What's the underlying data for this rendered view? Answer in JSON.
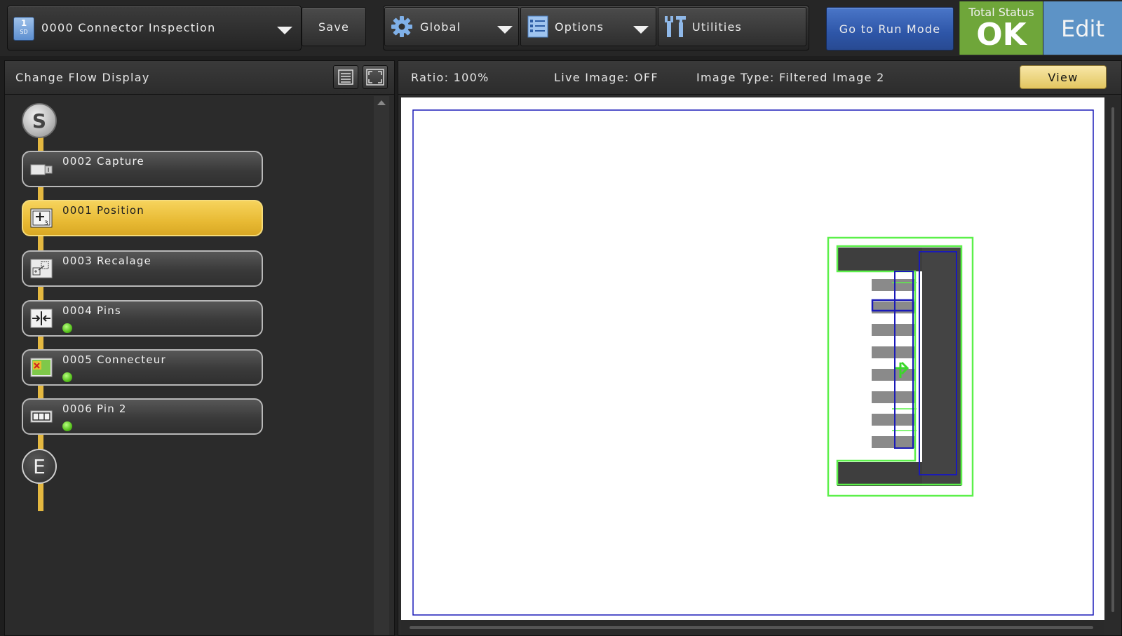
{
  "toolbar": {
    "scene": {
      "number": "1",
      "sub": "SD",
      "label": "0000  Connector  Inspection"
    },
    "save_label": "Save",
    "global_label": "Global",
    "options_label": "Options",
    "utilities_label": "Utilities",
    "run_mode_label": "Go  to  Run  Mode",
    "total_status_title": "Total Status",
    "total_status_value": "OK",
    "edit_label": "Edit"
  },
  "flow_panel": {
    "title": "Change  Flow  Display",
    "start_label": "S",
    "end_label": "E",
    "items": [
      {
        "label": "0002 Capture",
        "icon": "camera-icon",
        "active": false,
        "status": null
      },
      {
        "label": "0001 Position",
        "icon": "position-icon",
        "active": true,
        "status": null
      },
      {
        "label": "0003 Recalage",
        "icon": "recalage-icon",
        "active": false,
        "status": null
      },
      {
        "label": "0004 Pins",
        "icon": "pins-icon",
        "active": false,
        "status": "ok"
      },
      {
        "label": "0005 Connecteur",
        "icon": "connecteur-icon",
        "active": false,
        "status": "ok"
      },
      {
        "label": "0006 Pin  2",
        "icon": "pin2-icon",
        "active": false,
        "status": "ok"
      }
    ]
  },
  "image_panel": {
    "ratio_label": "Ratio:  100%",
    "live_label": "Live  Image:  OFF",
    "type_label": "Image  Type:  Filtered  Image  2",
    "view_label": "View"
  },
  "colors": {
    "accent_yellow": "#e8ba34",
    "status_ok_green": "#6fa63a",
    "edit_blue": "#5d93c6",
    "run_mode_blue": "#2e56a8",
    "roi_green": "#5cf04a",
    "roi_blue": "#1a1ab8"
  }
}
